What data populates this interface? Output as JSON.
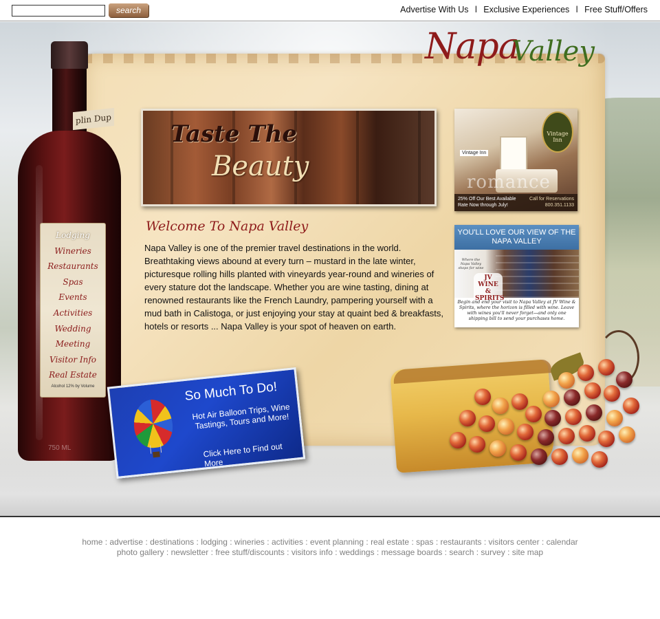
{
  "header": {
    "search_placeholder": "",
    "search_button": "search",
    "links": [
      "Advertise With Us",
      "Exclusive Experiences",
      "Free Stuff/Offers"
    ],
    "separator": "l"
  },
  "logo": {
    "napa": "Napa",
    "valley": "Valley"
  },
  "bottle": {
    "top_label": "plin Dup",
    "menu": [
      "Lodging",
      "Wineries",
      "Restaurants",
      "Spas",
      "Events",
      "Activities",
      "Wedding",
      "Meeting",
      "Visitor Info",
      "Real Estate"
    ],
    "alcohol": "Alcohol 12% by Volume",
    "volume": "750 ML"
  },
  "banner": {
    "line1": "Taste The",
    "line2": "Beauty"
  },
  "welcome": {
    "title": "Welcome To Napa Valley",
    "body": "Napa Valley is one of the premier travel destinations in the world. Breathtaking views abound at every turn – mustard in the late winter, picturesque rolling hills planted with vineyards year-round and wineries of every stature dot the landscape. Whether you are wine tasting, dining at renowned restaurants like the French Laundry, pampering yourself with a mud bath in Calistoga, or just enjoying your stay at quaint bed & breakfasts, hotels or resorts ... Napa Valley is your spot of heaven on earth."
  },
  "ad_inn": {
    "badge": "Vintage Inn",
    "tag": "Vintage Inn",
    "overlay": "romance",
    "offer": "25% Off Our Best Available Rate Now through July!",
    "call": "Call for Reservations 800.351.1133"
  },
  "ad_jv": {
    "headline": "YOU'LL LOVE OUR VIEW OF THE NAPA VALLEY",
    "tagline": "Where the Napa Valley shops for wine",
    "logo": "JV WINE & SPIRITS",
    "text": "Begin and end your visit to Napa Valley at JV Wine & Spirits, where the horizon is filled with wine. Leave with wines you'll never forget—and only one shipping bill to send your purchases home."
  },
  "promo": {
    "title": "So Much To Do!",
    "subtitle": "Hot Air Balloon Trips, Wine Tastings, Tours and More!",
    "link": "Click Here to Find out More"
  },
  "footer": {
    "row1": [
      "home",
      "advertise",
      "destinations",
      "lodging",
      "wineries",
      "activities",
      "event planning",
      "real estate",
      "spas",
      "restaurants",
      "visitors center",
      "calendar"
    ],
    "row2": [
      "photo gallery",
      "newsletter",
      "free stuff/discounts",
      "visitors info",
      "weddings",
      "message boards",
      "search",
      "survey",
      "site map"
    ],
    "separator": " : "
  }
}
